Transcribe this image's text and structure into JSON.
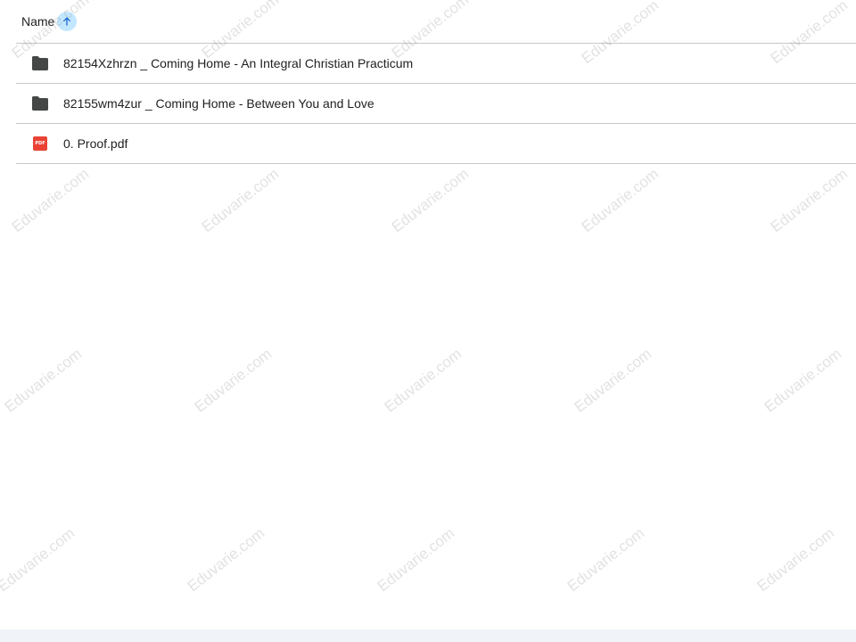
{
  "list_header": {
    "name_label": "Name",
    "sort_direction": "ascending",
    "sort_icon": "arrow-upward-icon"
  },
  "files": [
    {
      "name": "82154Xzhrzn _ Coming Home - An Integral Christian Practicum",
      "type": "folder",
      "icon": "folder-icon"
    },
    {
      "name": "82155wm4zur _ Coming Home - Between You and Love",
      "type": "folder",
      "icon": "folder-icon"
    },
    {
      "name": "0. Proof.pdf",
      "type": "pdf",
      "icon": "pdf-icon",
      "badge_text": "PDF"
    }
  ],
  "watermark": {
    "text": "Eduvarie.com"
  },
  "colors": {
    "sort_button_bg": "#c2e7ff",
    "sort_arrow": "#0b57d0",
    "folder": "#444746",
    "pdf": "#ea4335",
    "divider": "#c7c7c7"
  }
}
